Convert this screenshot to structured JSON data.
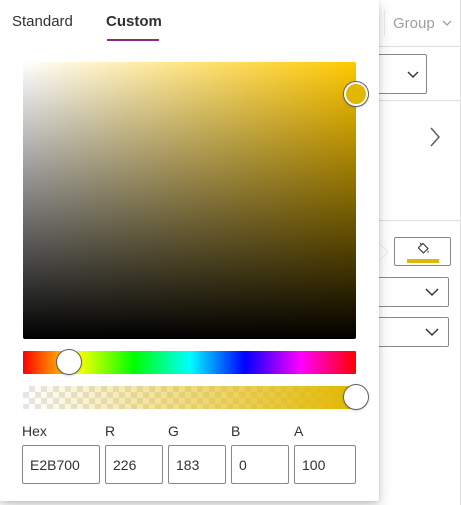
{
  "background_pane": {
    "group_label": "Group"
  },
  "picker": {
    "tabs": [
      {
        "label": "Standard",
        "active": false
      },
      {
        "label": "Custom",
        "active": true
      }
    ],
    "current_color": "#E2B700",
    "accent_color": "#8a2a85",
    "hue_degrees": 48,
    "saturation_value_thumb": {
      "saturation": 1.0,
      "value": 0.89
    },
    "alpha_percent": 100,
    "fields": {
      "hex": {
        "label": "Hex",
        "value": "E2B700"
      },
      "r": {
        "label": "R",
        "value": "226"
      },
      "g": {
        "label": "G",
        "value": "183"
      },
      "b": {
        "label": "B",
        "value": "0"
      },
      "a": {
        "label": "A",
        "value": "100"
      }
    }
  },
  "icons": {
    "group_chevron": "chevron-down-icon",
    "expand": "chevron-right-icon",
    "fill": "paint-bucket-icon"
  }
}
